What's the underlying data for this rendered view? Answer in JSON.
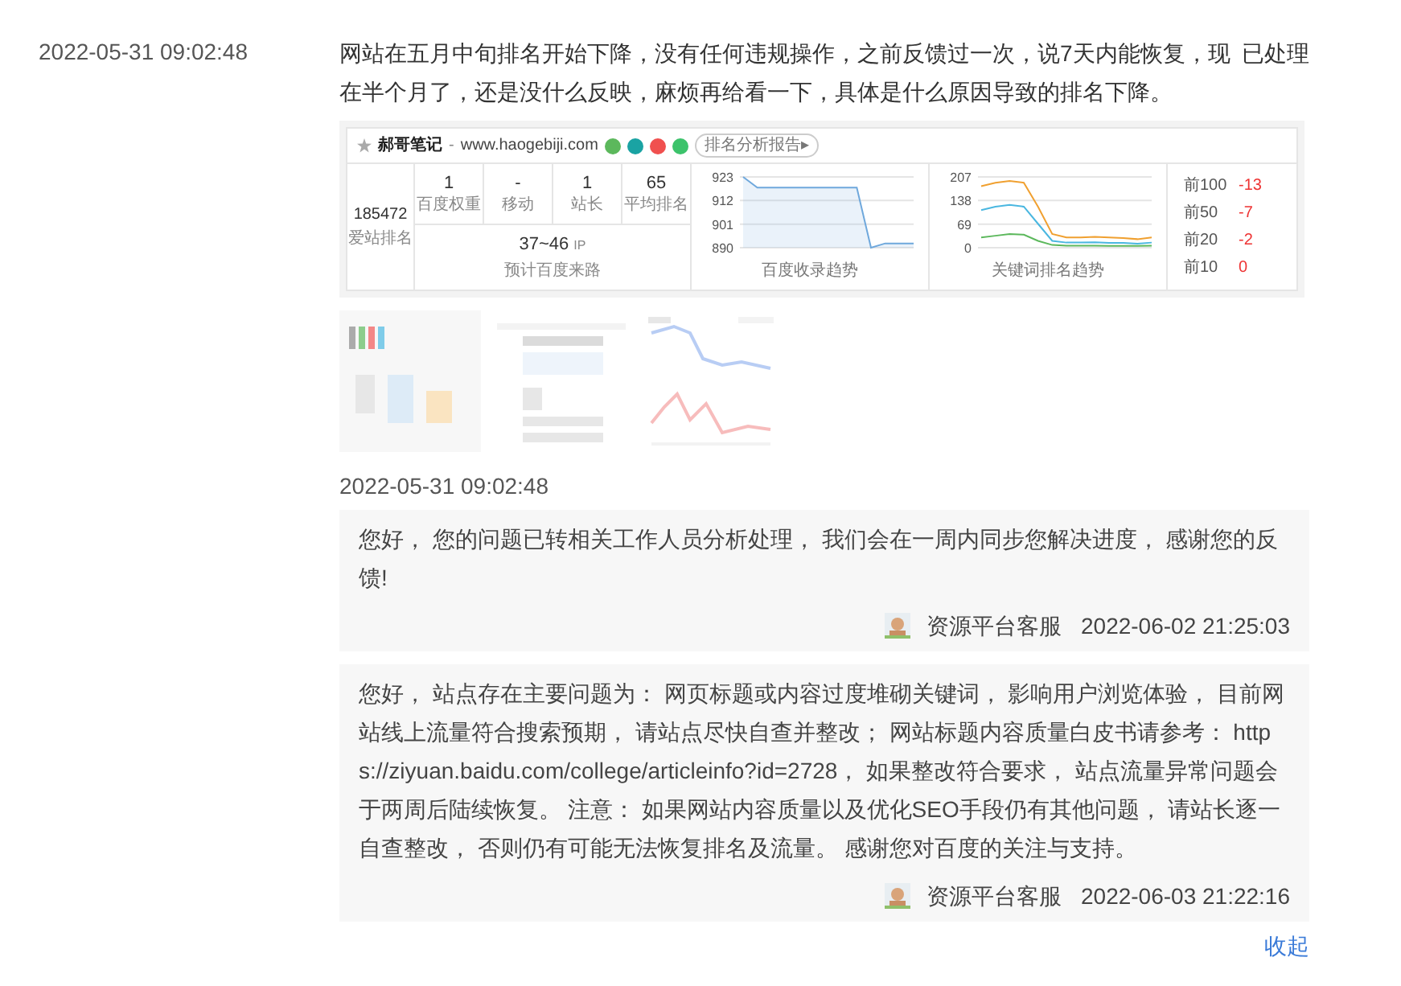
{
  "feedback": {
    "date": "2022-05-31 09:02:48",
    "status": "已处理",
    "text": "网站在五月中旬排名开始下降，没有任何违规操作，之前反馈过一次，说7天内能恢复，现在半个月了，还是没什么反映，麻烦再给看一下，具体是什么原因导致的排名下降。"
  },
  "screenshot": {
    "site_name": "郝哥笔记",
    "separator": "-",
    "domain": "www.haogebiji.com",
    "badges": [
      {
        "color": "#5cb85c"
      },
      {
        "color": "#1aa3a3"
      },
      {
        "color": "#f0504f"
      },
      {
        "color": "#3cc36b"
      }
    ],
    "report_button": "排名分析报告▸",
    "rank": {
      "value": "185472",
      "label": "爱站排名"
    },
    "stats": [
      {
        "value": "1",
        "label": "百度权重"
      },
      {
        "value": "-",
        "label": "移动"
      },
      {
        "value": "1",
        "label": "站长"
      },
      {
        "value": "65",
        "label": "平均排名"
      }
    ],
    "traffic": {
      "value": "37~46",
      "unit": "IP",
      "label": "预计百度来路"
    },
    "charts": [
      {
        "caption": "百度收录趋势",
        "chart_data": {
          "type": "area",
          "yticks": [
            890,
            901,
            912,
            923
          ],
          "ylim": [
            890,
            923
          ],
          "series": [
            {
              "color": "#6fa8dc",
              "values": [
                923,
                918,
                918,
                918,
                918,
                918,
                918,
                918,
                918,
                890,
                892,
                892,
                892
              ]
            }
          ]
        }
      },
      {
        "caption": "关键词排名趋势",
        "chart_data": {
          "type": "line",
          "yticks": [
            0,
            69,
            138,
            207
          ],
          "ylim": [
            0,
            207
          ],
          "series": [
            {
              "color": "#f0a030",
              "values": [
                180,
                190,
                195,
                190,
                120,
                40,
                30,
                30,
                32,
                30,
                28,
                25,
                30
              ]
            },
            {
              "color": "#4ab7e0",
              "values": [
                110,
                120,
                125,
                120,
                70,
                20,
                15,
                15,
                16,
                14,
                14,
                12,
                15
              ]
            },
            {
              "color": "#5cb85c",
              "values": [
                30,
                35,
                40,
                38,
                20,
                8,
                6,
                6,
                6,
                5,
                5,
                5,
                6
              ]
            }
          ]
        }
      }
    ],
    "legend": [
      {
        "label": "前100",
        "change": "-13"
      },
      {
        "label": "前50",
        "change": "-7"
      },
      {
        "label": "前20",
        "change": "-2"
      },
      {
        "label": "前10",
        "change": "0"
      }
    ]
  },
  "submitted": "2022-05-31 09:02:48",
  "replies": [
    {
      "text": "您好， 您的问题已转相关工作人员分析处理， 我们会在一周内同步您解决进度， 感谢您的反馈!",
      "author": "资源平台客服",
      "time": "2022-06-02 21:25:03"
    },
    {
      "text": "您好， 站点存在主要问题为： 网页标题或内容过度堆砌关键词， 影响用户浏览体验， 目前网站线上流量符合搜索预期， 请站点尽快自查并整改； 网站标题内容质量白皮书请参考： https://ziyuan.baidu.com/college/articleinfo?id=2728， 如果整改符合要求， 站点流量异常问题会于两周后陆续恢复。 注意： 如果网站内容质量以及优化SEO手段仍有其他问题， 请站长逐一自查整改， 否则仍有可能无法恢复排名及流量。 感谢您对百度的关注与支持。",
      "author": "资源平台客服",
      "time": "2022-06-03 21:22:16"
    }
  ],
  "collapse_link": "收起"
}
